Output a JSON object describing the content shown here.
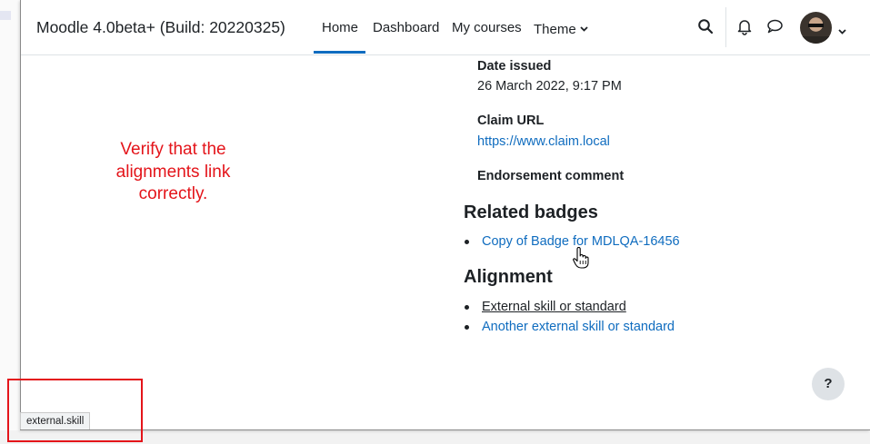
{
  "navbar": {
    "site_name": "Moodle 4.0beta+ (Build: 20220325)",
    "items": [
      {
        "label": "Home",
        "active": true
      },
      {
        "label": "Dashboard",
        "active": false
      },
      {
        "label": "My courses",
        "active": false
      },
      {
        "label": "Theme",
        "active": false
      }
    ],
    "icons": [
      "search-icon",
      "bell-icon",
      "chat-icon",
      "avatar",
      "chevron-down-icon"
    ],
    "accent_color": "#0f6cbf"
  },
  "badge_details": {
    "date_issued_label": "Date issued",
    "date_issued_value": "26 March 2022, 9:17 PM",
    "claim_url_label": "Claim URL",
    "claim_url_value": "https://www.claim.local",
    "endorsement_comment_label": "Endorsement comment"
  },
  "related_badges": {
    "heading": "Related badges",
    "items": [
      "Copy of Badge for MDLQA-16456"
    ]
  },
  "alignment": {
    "heading": "Alignment",
    "items": [
      "External skill or standard",
      "Another external skill or standard"
    ]
  },
  "annotation": {
    "text": "Verify that the alignments link correctly.",
    "color": "#e4141a"
  },
  "help_button": {
    "label": "?"
  },
  "status_bar": {
    "text": "external.skill"
  }
}
